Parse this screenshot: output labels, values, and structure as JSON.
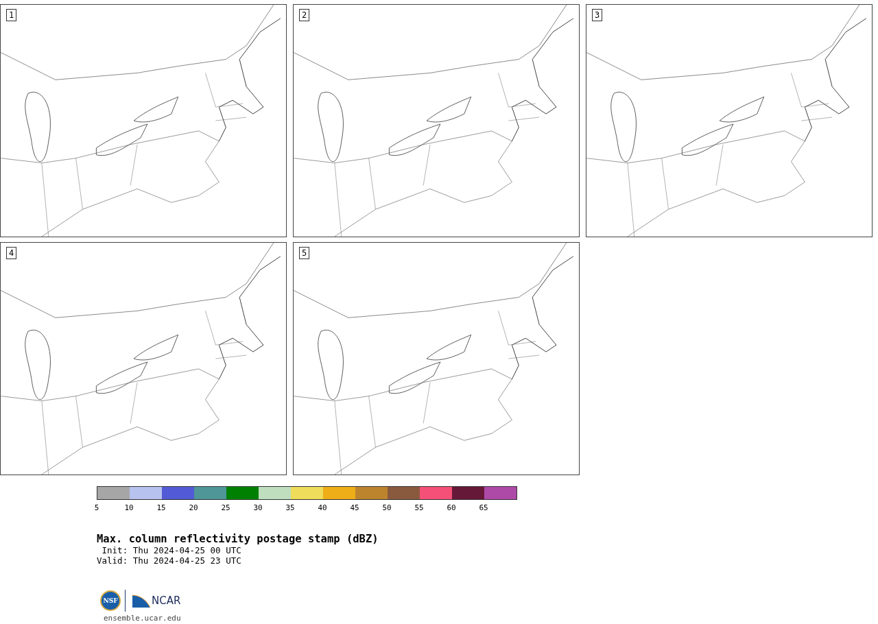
{
  "panels": [
    {
      "label": "1"
    },
    {
      "label": "2"
    },
    {
      "label": "3"
    },
    {
      "label": "4"
    },
    {
      "label": "5"
    }
  ],
  "colorbar": {
    "bins": [
      {
        "color": "#a6a6a6"
      },
      {
        "color": "#b8c2ee"
      },
      {
        "color": "#525ad6"
      },
      {
        "color": "#4f9699"
      },
      {
        "color": "#008000"
      },
      {
        "color": "#bedebe"
      },
      {
        "color": "#eedc5a"
      },
      {
        "color": "#eeae18"
      },
      {
        "color": "#bd842e"
      },
      {
        "color": "#8a5a3e"
      },
      {
        "color": "#f45078"
      },
      {
        "color": "#661838"
      },
      {
        "color": "#ad4aa8"
      }
    ],
    "ticks": [
      "5",
      "10",
      "15",
      "20",
      "25",
      "30",
      "35",
      "40",
      "45",
      "50",
      "55",
      "60",
      "65"
    ]
  },
  "title": "Max. column reflectivity postage stamp (dBZ)",
  "init": " Init: Thu 2024-04-25 00 UTC",
  "valid": "Valid: Thu 2024-04-25 23 UTC",
  "logos": {
    "nsf": "NSF",
    "ncar": "NCAR"
  },
  "site": "ensemble.ucar.edu"
}
